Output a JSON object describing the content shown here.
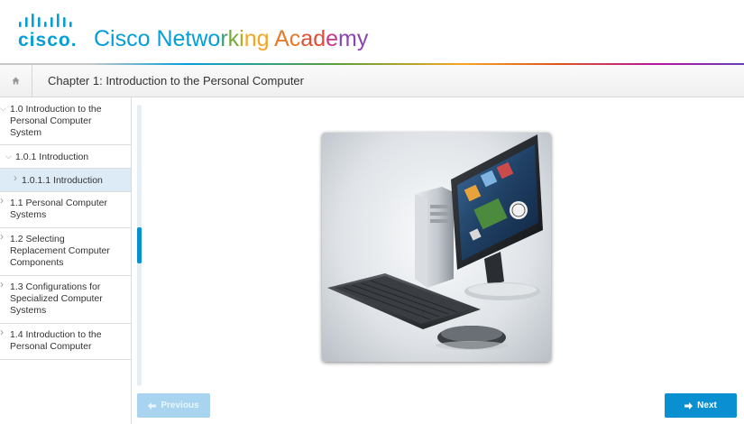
{
  "brand": {
    "logo_word": "cisco.",
    "title_parts": [
      {
        "text": "Cisco ",
        "color": "#049fd9"
      },
      {
        "text": "Netwo",
        "color": "#049fd9"
      },
      {
        "text": "r",
        "color": "#3d9e7a"
      },
      {
        "text": "k",
        "color": "#7aa93b"
      },
      {
        "text": "i",
        "color": "#b8a72b"
      },
      {
        "text": "ng ",
        "color": "#f5a623"
      },
      {
        "text": "Ac",
        "color": "#e57b2a"
      },
      {
        "text": "ad",
        "color": "#df4f35"
      },
      {
        "text": "e",
        "color": "#c9378a"
      },
      {
        "text": "my",
        "color": "#8b44b3"
      }
    ]
  },
  "chapter": {
    "home_icon": "home-icon",
    "title": "Chapter 1: Introduction to the Personal Computer"
  },
  "sidebar": {
    "items": [
      {
        "label": "1.0 Introduction to the Personal Computer System",
        "lines": [
          "1.0 Introduction to the",
          "Personal Computer",
          "System"
        ],
        "expanded": true,
        "level": 0
      },
      {
        "label": "1.0.1 Introduction",
        "lines": [
          "1.0.1 Introduction"
        ],
        "expanded": true,
        "level": 1
      },
      {
        "label": "1.0.1.1 Introduction",
        "lines": [
          "1.0.1.1 Introduction"
        ],
        "expanded": false,
        "level": 2,
        "selected": true
      },
      {
        "label": "1.1 Personal Computer Systems",
        "lines": [
          "1.1 Personal Computer",
          "Systems"
        ],
        "expanded": false,
        "level": 0
      },
      {
        "label": "1.2 Selecting Replacement Computer Components",
        "lines": [
          "1.2 Selecting",
          "Replacement Computer",
          "Components"
        ],
        "expanded": false,
        "level": 0
      },
      {
        "label": "1.3 Configurations for Specialized Computer Systems",
        "lines": [
          "1.3 Configurations for",
          "Specialized Computer",
          "Systems"
        ],
        "expanded": false,
        "level": 0
      },
      {
        "label": "1.4 Introduction to the Personal Computer",
        "lines": [
          "1.4 Introduction to the",
          "Personal Computer"
        ],
        "expanded": false,
        "level": 0
      }
    ]
  },
  "navigation": {
    "previous_label": "Previous",
    "next_label": "Next",
    "previous_enabled": false,
    "next_enabled": true
  },
  "colors": {
    "accent": "#0a8fd0",
    "cisco_blue": "#049fd9",
    "selected_bg": "#dcebf6"
  }
}
